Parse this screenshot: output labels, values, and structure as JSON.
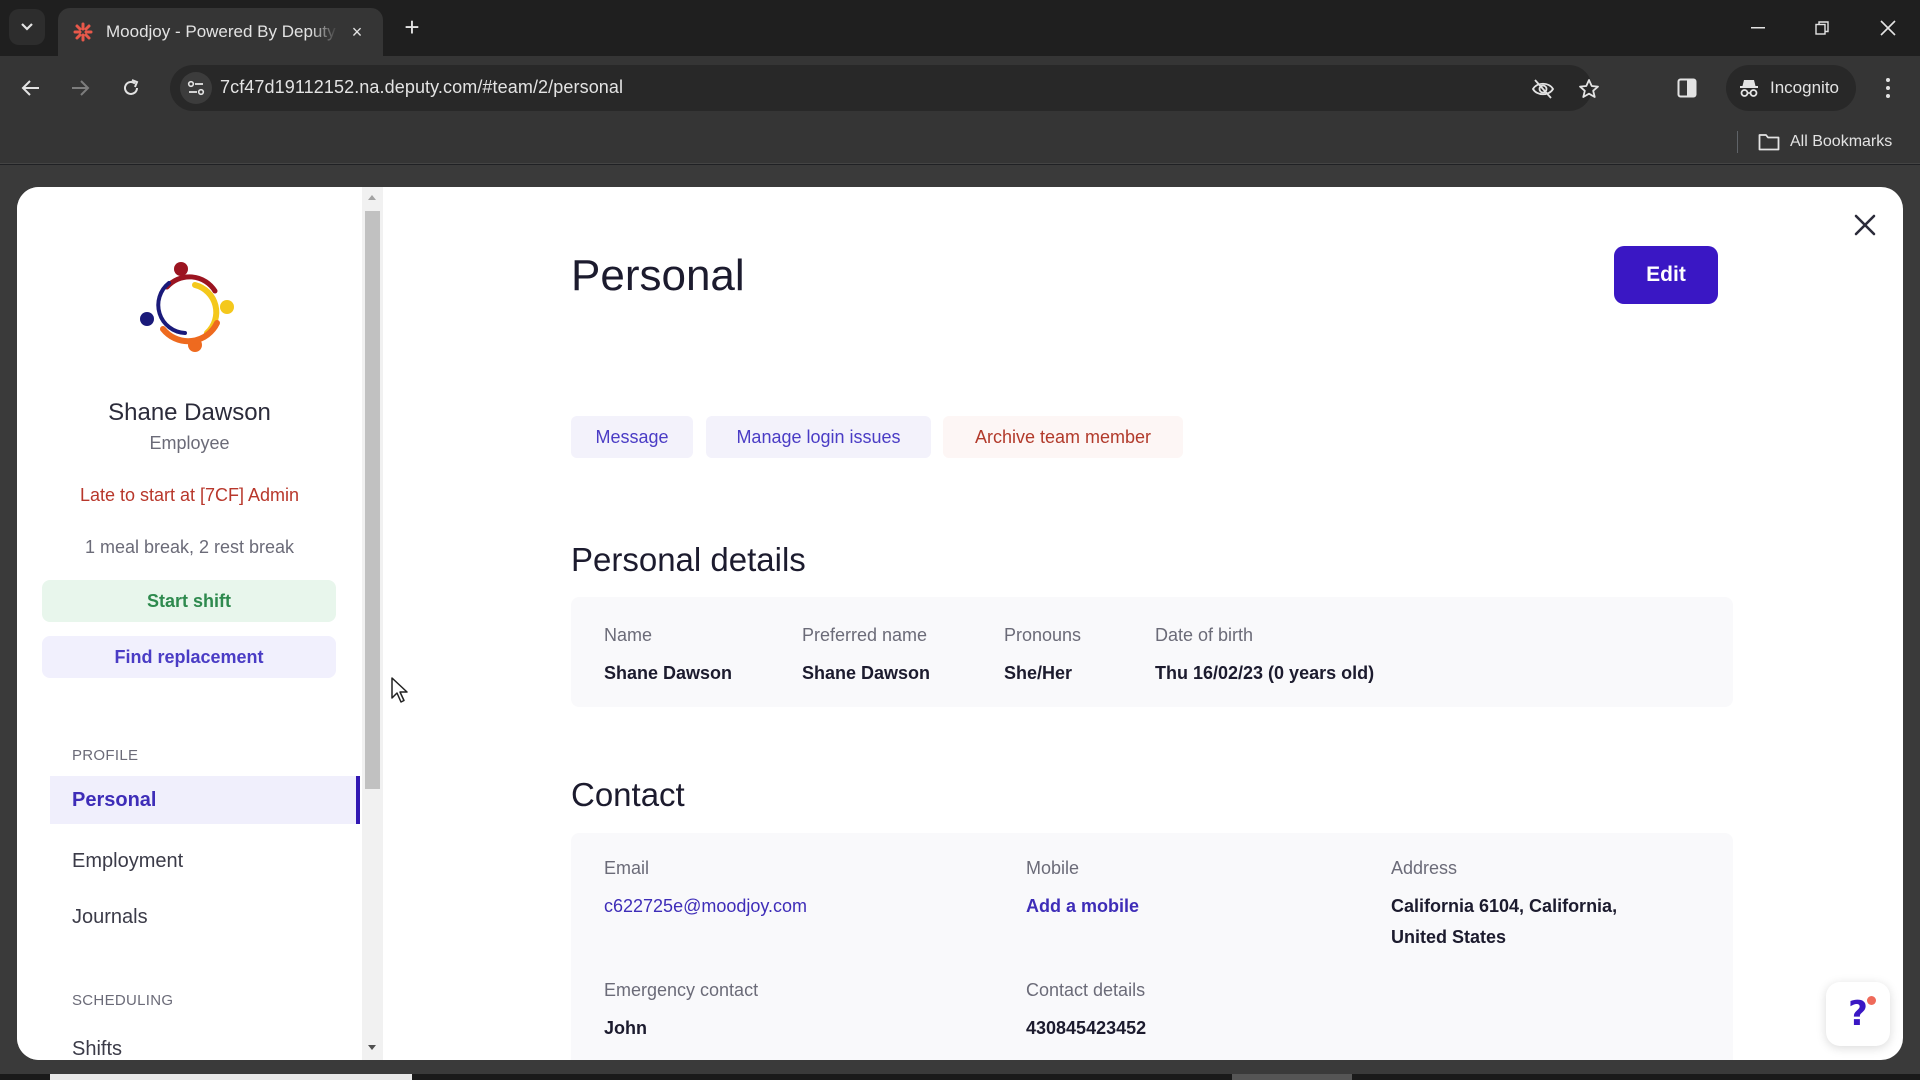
{
  "browser": {
    "tab": {
      "title": "Moodjoy - Powered By Deputy",
      "close_label": "×"
    },
    "new_tab_label": "+",
    "url": "7cf47d19112152.na.deputy.com/#team/2/personal",
    "incognito_label": "Incognito",
    "all_bookmarks_label": "All Bookmarks",
    "icons": {
      "tab_search": "chevron-down-icon",
      "back": "arrow-left-icon",
      "forward": "arrow-right-icon",
      "reload": "reload-icon",
      "site_info": "tune-icon",
      "eye_off": "eye-off-icon",
      "bookmark_star": "star-icon",
      "side_panel": "side-panel-icon",
      "menu": "kebab-menu-icon",
      "folder": "folder-icon"
    }
  },
  "sidebar": {
    "employee": {
      "name": "Shane Dawson",
      "role": "Employee",
      "status": "Late to start at [7CF] Admin",
      "breaks": "1 meal break, 2 rest break"
    },
    "buttons": {
      "start_shift": "Start shift",
      "find_replacement": "Find replacement"
    },
    "sections": [
      {
        "title": "PROFILE",
        "items": [
          {
            "label": "Personal",
            "active": true
          },
          {
            "label": "Employment",
            "active": false
          },
          {
            "label": "Journals",
            "active": false
          }
        ]
      },
      {
        "title": "SCHEDULING",
        "items": [
          {
            "label": "Shifts",
            "active": false
          }
        ]
      }
    ]
  },
  "main": {
    "title": "Personal",
    "edit_label": "Edit",
    "actions": {
      "message": "Message",
      "manage_login": "Manage login issues",
      "archive": "Archive team member"
    },
    "personal_details": {
      "heading": "Personal details",
      "fields": [
        {
          "label": "Name",
          "value": "Shane Dawson"
        },
        {
          "label": "Preferred name",
          "value": "Shane Dawson"
        },
        {
          "label": "Pronouns",
          "value": "She/Her"
        },
        {
          "label": "Date of birth",
          "value": "Thu 16/02/23 (0 years old)"
        }
      ]
    },
    "contact": {
      "heading": "Contact",
      "email_label": "Email",
      "email_value": "c622725e@moodjoy.com",
      "mobile_label": "Mobile",
      "mobile_value": "Add a mobile",
      "address_label": "Address",
      "address_line1": "California 6104, California,",
      "address_line2": "United States",
      "emergency_label": "Emergency contact",
      "emergency_value": "John",
      "contact_details_label": "Contact details",
      "contact_details_value": "430845423452"
    },
    "help_label": "?"
  },
  "colors": {
    "brand_primary": "#3a17c4",
    "link": "#3e2db8",
    "danger": "#b23a2b",
    "success": "#2e8a4e"
  }
}
